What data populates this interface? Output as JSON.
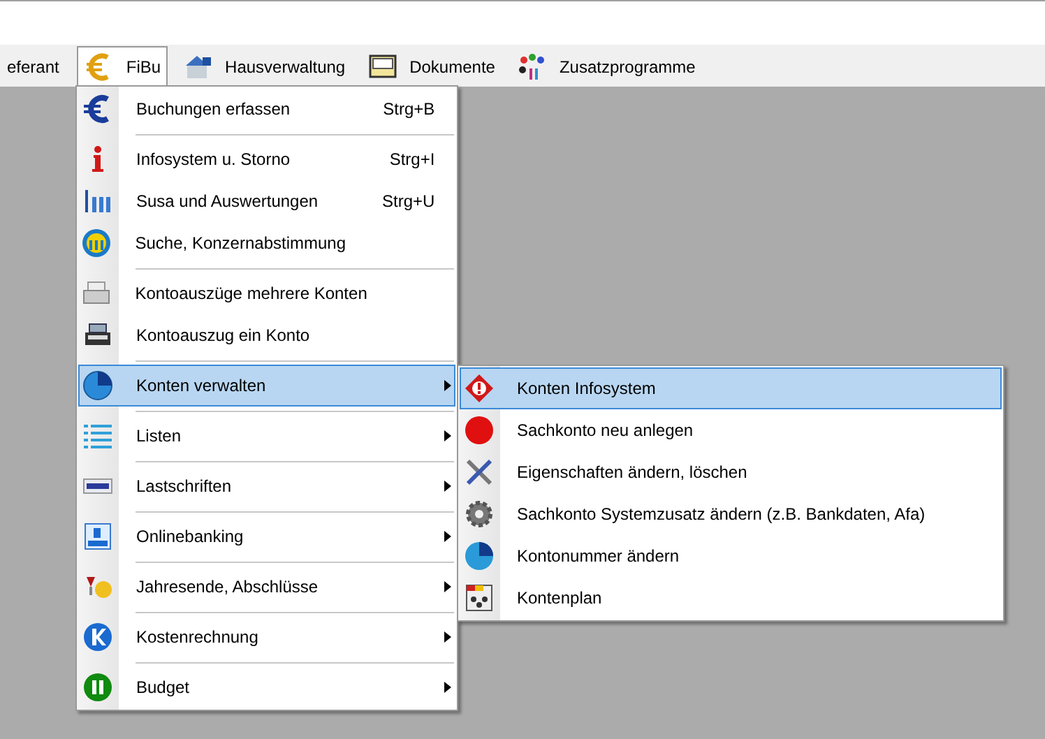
{
  "menu_bar": [
    {
      "label": "eferant",
      "selected": false
    },
    {
      "label": "FiBu",
      "selected": true
    },
    {
      "label": "Hausverwaltung",
      "selected": false
    },
    {
      "label": "Dokumente",
      "selected": false
    },
    {
      "label": "Zusatzprogramme",
      "selected": false
    }
  ],
  "fibu_menu": {
    "groups": [
      [
        {
          "label": "Buchungen erfassen",
          "shortcut": "Strg+B",
          "has_submenu": false,
          "selected": false
        }
      ],
      [
        {
          "label": "Infosystem u. Storno",
          "shortcut": "Strg+I",
          "has_submenu": false,
          "selected": false
        },
        {
          "label": "Susa und Auswertungen",
          "shortcut": "Strg+U",
          "has_submenu": false,
          "selected": false
        },
        {
          "label": "Suche, Konzernabstimmung",
          "has_submenu": false,
          "selected": false
        }
      ],
      [
        {
          "label": "Kontoauszüge mehrere Konten",
          "has_submenu": false,
          "selected": false
        },
        {
          "label": "Kontoauszug ein Konto",
          "has_submenu": false,
          "selected": false
        }
      ],
      [
        {
          "label": "Konten verwalten",
          "has_submenu": true,
          "selected": true
        }
      ],
      [
        {
          "label": "Listen",
          "has_submenu": true,
          "selected": false
        }
      ],
      [
        {
          "label": "Lastschriften",
          "has_submenu": true,
          "selected": false
        }
      ],
      [
        {
          "label": "Onlinebanking",
          "has_submenu": true,
          "selected": false
        }
      ],
      [
        {
          "label": "Jahresende, Abschlüsse",
          "has_submenu": true,
          "selected": false
        }
      ],
      [
        {
          "label": "Kostenrechnung",
          "has_submenu": true,
          "selected": false
        }
      ],
      [
        {
          "label": "Budget",
          "has_submenu": true,
          "selected": false
        }
      ]
    ]
  },
  "submenu": {
    "items": [
      {
        "label": "Konten Infosystem",
        "selected": true
      },
      {
        "label": "Sachkonto neu anlegen",
        "selected": false
      },
      {
        "label": "Eigenschaften ändern, löschen",
        "selected": false
      },
      {
        "label": "Sachkonto Systemzusatz ändern (z.B. Bankdaten, Afa)",
        "selected": false
      },
      {
        "label": "Kontonummer ändern",
        "selected": false
      },
      {
        "label": "Kontenplan",
        "selected": false
      }
    ]
  }
}
